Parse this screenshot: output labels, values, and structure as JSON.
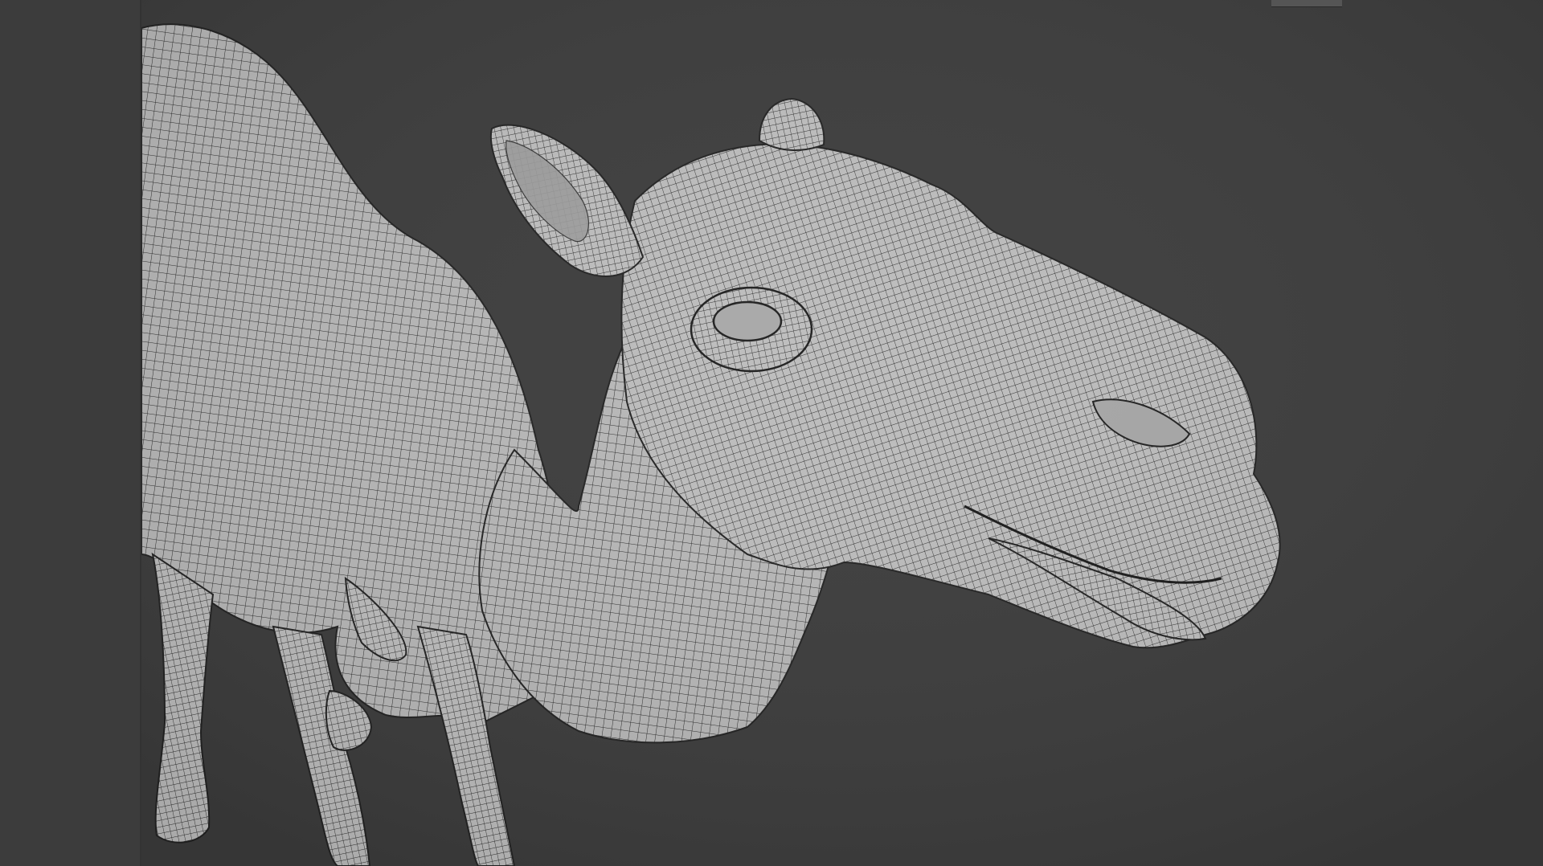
{
  "viewport": {
    "background_color": "#3c3c3c",
    "shading": "solid-with-wireframe",
    "model_color": "#b9b9b9",
    "wire_color": "#2b2b2b"
  },
  "scene": {
    "model": "camel-wireframe-mesh"
  },
  "icons": {
    "corner_widget": "viewport-header-tab"
  }
}
